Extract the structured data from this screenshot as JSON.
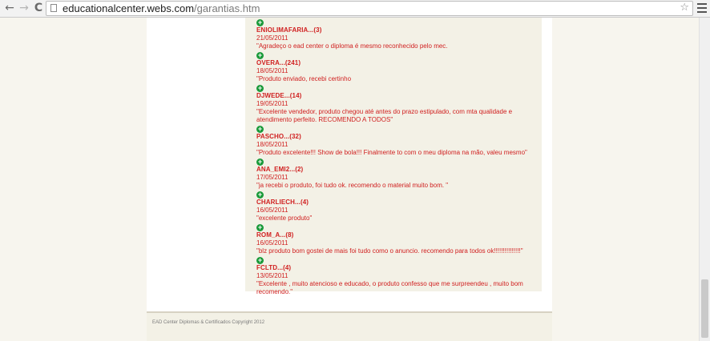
{
  "browser": {
    "url_domain": "educationalcenter.webs.com",
    "url_path": "/garantias.htm",
    "back_icon": "←",
    "forward_icon": "→",
    "reload_icon": "C",
    "star_icon": "☆"
  },
  "feedback": [
    {
      "user": "ENIOLIMAFARIA...(3)",
      "date": "21/05/2011",
      "text": "\"Agradeço o ead center o diploma é mesmo reconhecido pelo mec."
    },
    {
      "user": "OVERA...(241)",
      "date": "18/05/2011",
      "text": "\"Produto enviado, recebi certinho"
    },
    {
      "user": "DJWEDE...(14)",
      "date": "19/05/2011",
      "text": "\"Excelente vendedor, produto chegou até antes do prazo estipulado, com mta qualidade e atendimento perfeito. RECOMENDO A TODOS\""
    },
    {
      "user": "PASCHO...(32)",
      "date": "18/05/2011",
      "text": "\"Produto excelente!!! Show de bola!!! Finalmente to com o meu diploma na mão, valeu mesmo\""
    },
    {
      "user": "ANA_EMI2...(2)",
      "date": "17/05/2011",
      "text": "\"ja recebi o produto, foi tudo ok. recomendo o material muito bom. \""
    },
    {
      "user": "CHARLIECH...(4)",
      "date": "16/05/2011",
      "text": "\"excelente produto\""
    },
    {
      "user": "ROM_A...(8)",
      "date": "16/05/2011",
      "text": "\"blz produto bom gostei de mais foi tudo como o anuncio. recomendo para todos ok!!!!!!!!!!!!!!!\""
    },
    {
      "user": "FCLTD...(4)",
      "date": "13/05/2011",
      "text": "\"Excelente , muito atencioso e educado, o produto confesso que me surpreendeu , muito bom recomendo.\""
    }
  ],
  "plus_icon_glyph": "+",
  "footer": {
    "copyright": "EAD Center Diplomas & Certificados Copyright 2012"
  },
  "colors": {
    "feedback_text": "#d02020",
    "plus_icon": "#1a9a3a",
    "content_bg": "#f3f1e6"
  }
}
